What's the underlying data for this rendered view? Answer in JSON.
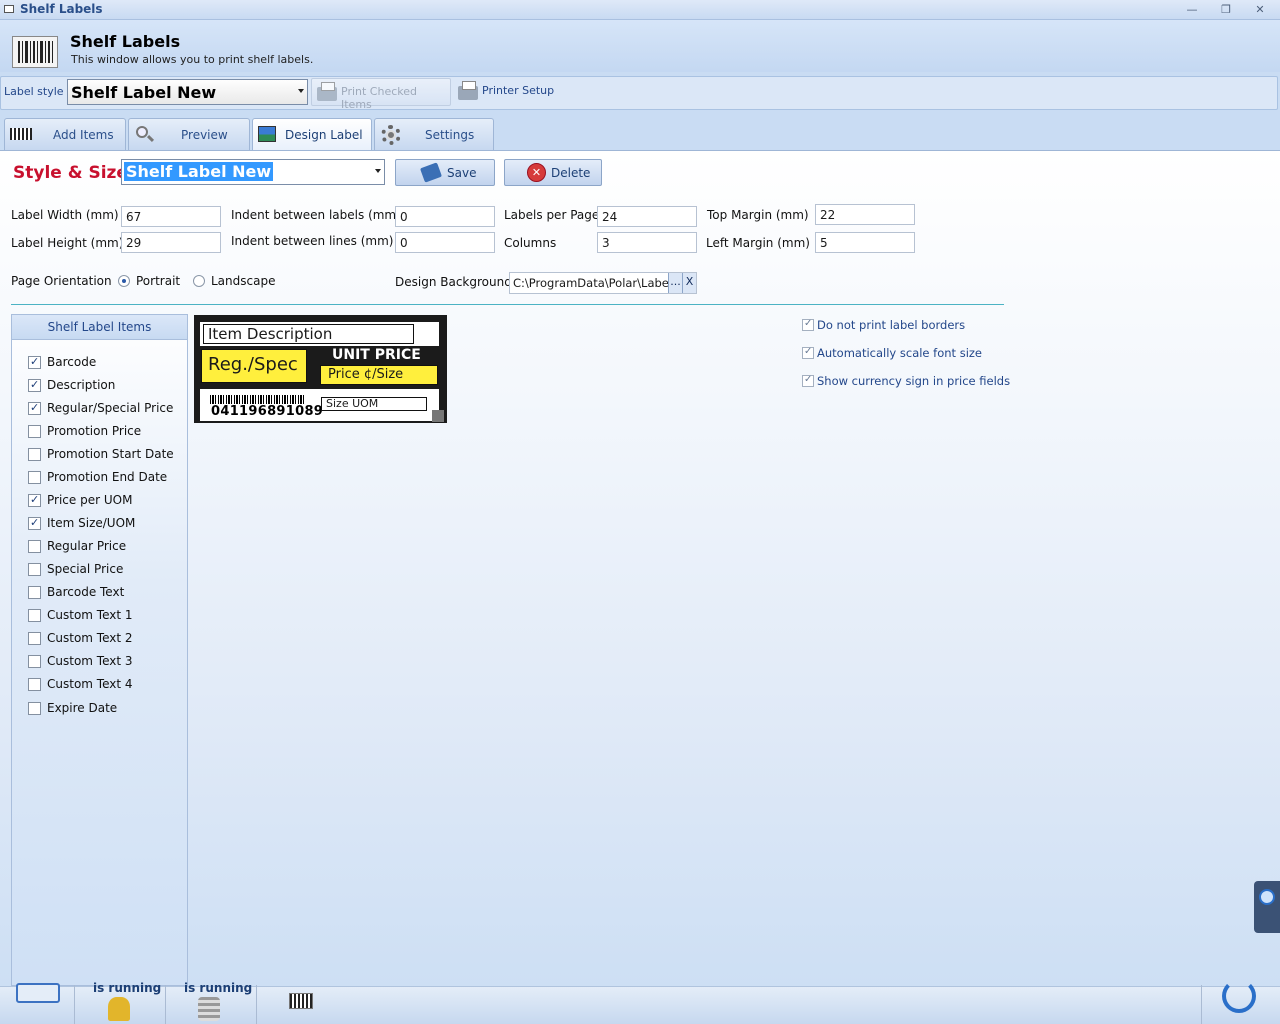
{
  "window": {
    "title": "Shelf Labels"
  },
  "header": {
    "title": "Shelf Labels",
    "subtitle": "This window allows you to print shelf labels."
  },
  "toolbar": {
    "label_style_label": "Label style",
    "label_style_value": "Shelf Label New",
    "print_checked": "Print Checked Items",
    "printer_setup": "Printer Setup"
  },
  "tabs": [
    {
      "label": "Add Items",
      "active": false
    },
    {
      "label": "Preview",
      "active": false
    },
    {
      "label": "Design Label",
      "active": true
    },
    {
      "label": "Settings",
      "active": false
    }
  ],
  "design": {
    "style_size_title": "Style & Size",
    "style_value": "Shelf Label New",
    "save": "Save",
    "delete": "Delete",
    "fields": {
      "label_width": {
        "label": "Label Width (mm)",
        "value": "67"
      },
      "label_height": {
        "label": "Label Height (mm)",
        "value": "29"
      },
      "indent_labels": {
        "label": "Indent between labels (mm)",
        "value": "0"
      },
      "indent_lines": {
        "label": "Indent between lines (mm)",
        "value": "0"
      },
      "labels_per_page": {
        "label": "Labels per Page",
        "value": "24"
      },
      "columns": {
        "label": "Columns",
        "value": "3"
      },
      "top_margin": {
        "label": "Top Margin (mm)",
        "value": "22"
      },
      "left_margin": {
        "label": "Left Margin (mm)",
        "value": "5"
      }
    },
    "orientation": {
      "label": "Page Orientation",
      "portrait": "Portrait",
      "landscape": "Landscape",
      "selected": "Portrait"
    },
    "background": {
      "label": "Design Background",
      "value": "C:\\ProgramData\\Polar\\Labels",
      "browse": "...",
      "clear": "X"
    }
  },
  "items_panel": {
    "title": "Shelf Label Items",
    "items": [
      {
        "label": "Barcode",
        "checked": true
      },
      {
        "label": "Description",
        "checked": true
      },
      {
        "label": "Regular/Special Price",
        "checked": true
      },
      {
        "label": "Promotion Price",
        "checked": false
      },
      {
        "label": "Promotion Start Date",
        "checked": false
      },
      {
        "label": "Promotion End Date",
        "checked": false
      },
      {
        "label": "Price per UOM",
        "checked": true
      },
      {
        "label": "Item Size/UOM",
        "checked": true
      },
      {
        "label": "Regular Price",
        "checked": false
      },
      {
        "label": "Special Price",
        "checked": false
      },
      {
        "label": "Barcode Text",
        "checked": false
      },
      {
        "label": "Custom Text 1",
        "checked": false
      },
      {
        "label": "Custom Text 2",
        "checked": false
      },
      {
        "label": "Custom Text 3",
        "checked": false
      },
      {
        "label": "Custom Text 4",
        "checked": false
      },
      {
        "label": "Expire Date",
        "checked": false
      }
    ]
  },
  "label_preview": {
    "description": "Item Description",
    "reg_spec": "Reg./Spec",
    "unit_price": "UNIT PRICE",
    "price_size": "Price ¢/Size",
    "barcode_number": "041196891089",
    "size_uom": "Size UOM"
  },
  "options": [
    {
      "label": "Do not print label borders",
      "checked": true
    },
    {
      "label": "Automatically scale font size",
      "checked": true
    },
    {
      "label": "Show currency sign in price fields",
      "checked": true
    }
  ],
  "taskbar": {
    "running_1": "is running",
    "running_2": "is running"
  }
}
